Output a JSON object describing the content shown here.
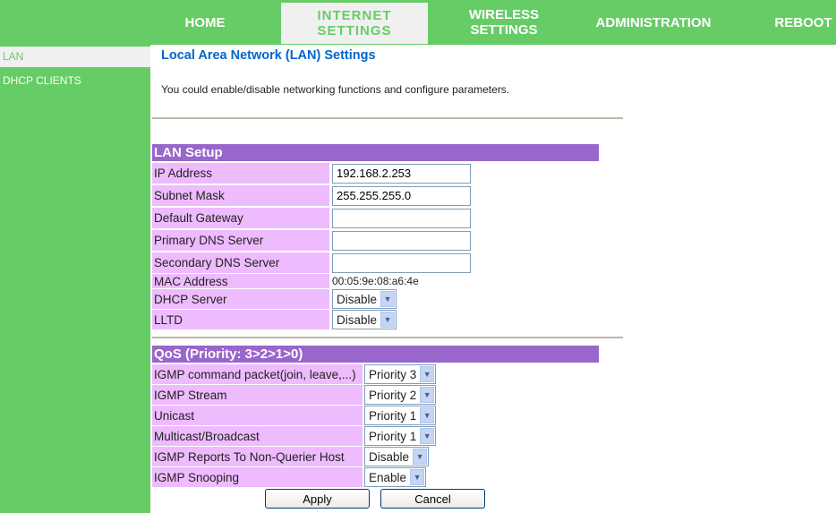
{
  "nav": [
    {
      "label": "HOME"
    },
    {
      "label": "INTERNET SETTINGS",
      "l1": "INTERNET",
      "l2": "SETTINGS"
    },
    {
      "label": "WIRELESS SETTINGS",
      "l1": "WIRELESS",
      "l2": "SETTINGS"
    },
    {
      "label": "ADMINISTRATION"
    },
    {
      "label": "REBOOT"
    }
  ],
  "sidebar": [
    {
      "label": "LAN"
    },
    {
      "label": "DHCP CLIENTS"
    }
  ],
  "page": {
    "title": "Local Area Network (LAN) Settings",
    "description": "You could enable/disable networking functions and configure parameters."
  },
  "lan": {
    "header": "LAN Setup",
    "ip_label": "IP Address",
    "ip": "192.168.2.253",
    "mask_label": "Subnet Mask",
    "mask": "255.255.255.0",
    "gw_label": "Default Gateway",
    "gw": "",
    "dns1_label": "Primary DNS Server",
    "dns1": "",
    "dns2_label": "Secondary DNS Server",
    "dns2": "",
    "mac_label": "MAC Address",
    "mac": "00:05:9e:08:a6:4e",
    "dhcp_label": "DHCP Server",
    "dhcp": "Disable",
    "lltd_label": "LLTD",
    "lltd": "Disable"
  },
  "qos": {
    "header": "QoS (Priority: 3>2>1>0)",
    "rows": [
      {
        "label": "IGMP command packet(join, leave,...)",
        "value": "Priority 3"
      },
      {
        "label": "IGMP Stream",
        "value": "Priority 2"
      },
      {
        "label": "Unicast",
        "value": "Priority 1"
      },
      {
        "label": "Multicast/Broadcast",
        "value": "Priority 1"
      },
      {
        "label": "IGMP Reports To Non-Querier Host",
        "value": "Disable"
      },
      {
        "label": "IGMP Snooping",
        "value": "Enable"
      }
    ]
  },
  "buttons": {
    "apply": "Apply",
    "cancel": "Cancel"
  },
  "colors": {
    "green": "#66cc66",
    "purple": "#9966cc",
    "pink": "#eebbff",
    "title": "#0066cc"
  }
}
